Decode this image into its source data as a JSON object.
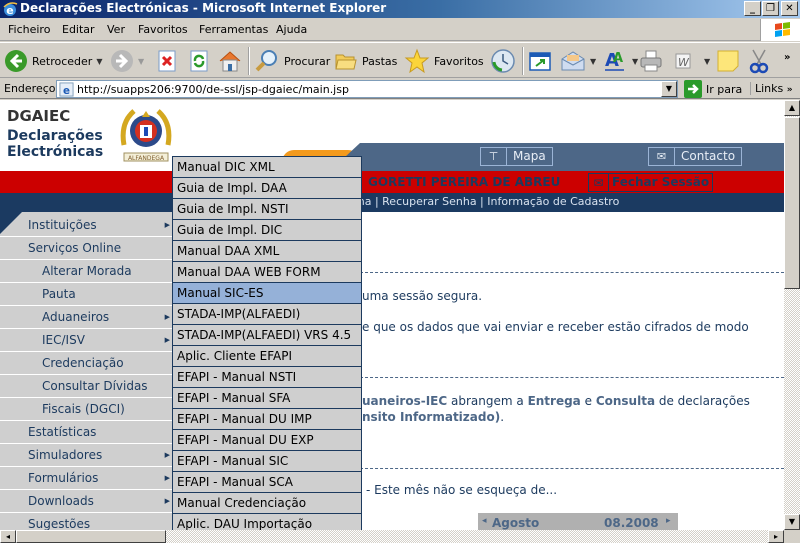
{
  "window": {
    "title": "Declarações Electrónicas - Microsoft Internet Explorer",
    "buttons": [
      "_",
      "❐",
      "✕"
    ]
  },
  "menubar": [
    "Ficheiro",
    "Editar",
    "Ver",
    "Favoritos",
    "Ferramentas",
    "Ajuda"
  ],
  "toolbar": {
    "back": "Retroceder",
    "search": "Procurar",
    "folders": "Pastas",
    "favorites": "Favoritos",
    "more": "»"
  },
  "address": {
    "label": "Endereço",
    "url": "http://suapps206:9700/de-ssl/jsp-dgaiec/main.jsp",
    "go": "Ir para",
    "links": "Links",
    "more": "»"
  },
  "site": {
    "org": "DGAIEC",
    "name_line1": "Declarações",
    "name_line2": "Electrónicas",
    "crest_caption": "ALFANDEGA",
    "nav": {
      "map": "Mapa",
      "contact": "Contacto"
    },
    "user": "GORETTI PEREIRA DE ABREU",
    "logout": "Fechar Sessão",
    "sublinks": "enha  |  Recuperar Senha  |  Informação de Cadastro"
  },
  "leftnav": [
    {
      "label": "Instituições",
      "indent": false,
      "submenu": true
    },
    {
      "label": "Serviços Online",
      "indent": false,
      "submenu": false
    },
    {
      "label": "Alterar Morada",
      "indent": true,
      "submenu": false
    },
    {
      "label": "Pauta",
      "indent": true,
      "submenu": false
    },
    {
      "label": "Aduaneiros",
      "indent": true,
      "submenu": true
    },
    {
      "label": "IEC/ISV",
      "indent": true,
      "submenu": true
    },
    {
      "label": "Credenciação",
      "indent": true,
      "submenu": false
    },
    {
      "label": "Consultar Dívidas",
      "indent": true,
      "submenu": false
    },
    {
      "label": "Fiscais (DGCI)",
      "indent": true,
      "submenu": false
    },
    {
      "label": "Estatísticas",
      "indent": false,
      "submenu": false
    },
    {
      "label": "Simuladores",
      "indent": false,
      "submenu": true
    },
    {
      "label": "Formulários",
      "indent": false,
      "submenu": true
    },
    {
      "label": "Downloads",
      "indent": false,
      "submenu": true
    },
    {
      "label": "Sugestões",
      "indent": false,
      "submenu": false
    }
  ],
  "dropdown": {
    "highlighted_index": 6,
    "items": [
      "Manual DIC XML",
      "Guia de Impl. DAA",
      "Guia de Impl. NSTI",
      "Guia de Impl. DIC",
      "Manual DAA XML",
      "Manual DAA WEB FORM",
      "Manual SIC-ES",
      "STADA-IMP(ALFAEDI)",
      "STADA-IMP(ALFAEDI) VRS 4.5",
      "Aplic. Cliente EFAPI",
      "EFAPI - Manual NSTI",
      "EFAPI - Manual SFA",
      "EFAPI - Manual DU IMP",
      "EFAPI - Manual DU EXP",
      "EFAPI - Manual SIC",
      "EFAPI - Manual SCA",
      "Manual Credenciação",
      "Aplic. DAU Importação"
    ]
  },
  "content": {
    "secure_session": "uma sessão segura.",
    "encrypted": "e que os dados que vai enviar e receber estão cifrados de modo",
    "scope_a": "uaneiros-IEC",
    "scope_b": " abrangem a ",
    "scope_c": "Entrega",
    "scope_d": " e ",
    "scope_e": "Consulta",
    "scope_f": " de declarações",
    "transit": "nsito Informatizado)",
    "transit_end": ".",
    "reminder": "- Este mês não se esqueça de...",
    "calendar": {
      "month": "Agosto",
      "date": "08.2008",
      "prev": "◂",
      "next": "▸"
    }
  }
}
